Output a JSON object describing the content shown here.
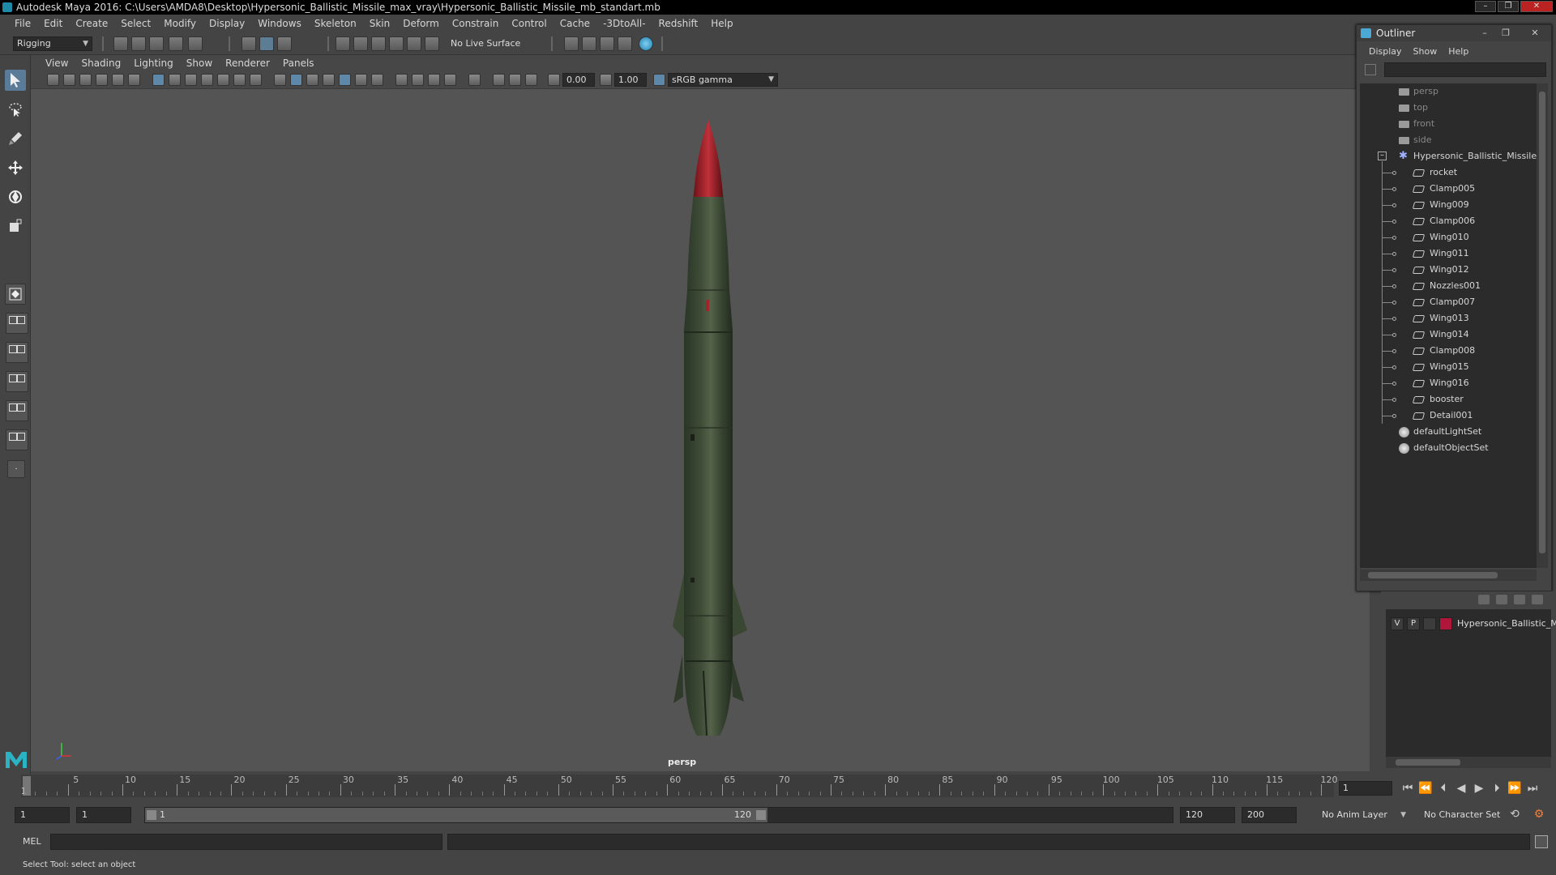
{
  "window": {
    "title": "Autodesk Maya 2016: C:\\Users\\AMDA8\\Desktop\\Hypersonic_Ballistic_Missile_max_vray\\Hypersonic_Ballistic_Missile_mb_standart.mb",
    "minimize": "–",
    "maximize": "❐",
    "close": "✕"
  },
  "menubar": [
    "File",
    "Edit",
    "Create",
    "Select",
    "Modify",
    "Display",
    "Windows",
    "Skeleton",
    "Skin",
    "Deform",
    "Constrain",
    "Control",
    "Cache",
    "-3DtoAll-",
    "Redshift",
    "Help"
  ],
  "statusline": {
    "menu_set": "Rigging",
    "live_surface": "No Live Surface"
  },
  "viewport": {
    "panel_menus": [
      "View",
      "Shading",
      "Lighting",
      "Show",
      "Renderer",
      "Panels"
    ],
    "exposure": "0.00",
    "gamma": "1.00",
    "color_space": "sRGB gamma",
    "camera_label": "persp"
  },
  "outliner": {
    "title": "Outliner",
    "menus": [
      "Display",
      "Show",
      "Help"
    ],
    "cameras": [
      "persp",
      "top",
      "front",
      "side"
    ],
    "group_name": "Hypersonic_Ballistic_Missile_r",
    "children": [
      "rocket",
      "Clamp005",
      "Wing009",
      "Clamp006",
      "Wing010",
      "Wing011",
      "Wing012",
      "Nozzles001",
      "Clamp007",
      "Wing013",
      "Wing014",
      "Clamp008",
      "Wing015",
      "Wing016",
      "booster",
      "Detail001"
    ],
    "sets": [
      "defaultLightSet",
      "defaultObjectSet"
    ]
  },
  "layer_editor": {
    "layer": {
      "visible": "V",
      "playback": "P",
      "color": "#b0163a",
      "name": "Hypersonic_Ballistic_M"
    }
  },
  "timeslider": {
    "ticks": [
      5,
      10,
      15,
      20,
      25,
      30,
      35,
      40,
      45,
      50,
      55,
      60,
      65,
      70,
      75,
      80,
      85,
      90,
      95,
      100,
      105,
      110,
      115,
      120
    ],
    "start_label": "1",
    "current_frame": "1"
  },
  "range": {
    "start_time": "1",
    "playback_start": "1",
    "range_start": "1",
    "range_end": "120",
    "playback_end": "120",
    "end_time": "200",
    "anim_layer": "No Anim Layer",
    "character_set": "No Character Set"
  },
  "cmdline": {
    "label": "MEL"
  },
  "helpline": {
    "text": "Select Tool: select an object"
  },
  "colors": {
    "missile_body": "#3b4a33",
    "missile_nose": "#a8202a",
    "accent": "#5a7c99"
  }
}
